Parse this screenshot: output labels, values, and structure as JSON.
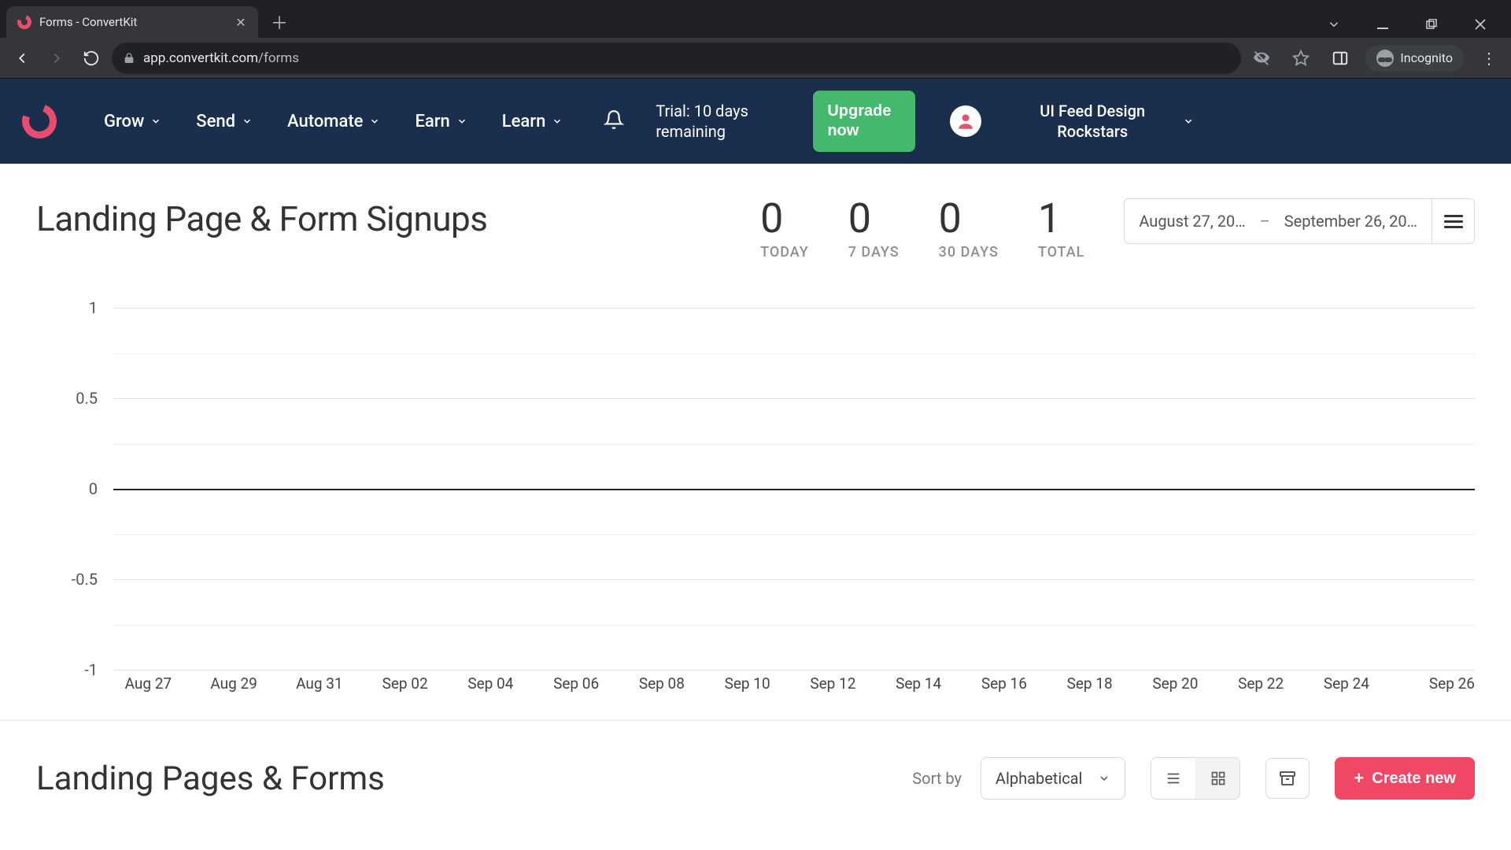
{
  "browser": {
    "tab_title": "Forms - ConvertKit",
    "url_host": "app.convertkit.com",
    "url_path": "/forms",
    "incognito_label": "Incognito"
  },
  "nav": {
    "items": [
      "Grow",
      "Send",
      "Automate",
      "Earn",
      "Learn"
    ],
    "trial_text": "Trial: 10 days remaining",
    "upgrade_label": "Upgrade now",
    "account_name": "UI Feed Design Rockstars"
  },
  "page": {
    "title": "Landing Page & Form Signups",
    "stats": [
      {
        "value": "0",
        "label": "TODAY"
      },
      {
        "value": "0",
        "label": "7 DAYS"
      },
      {
        "value": "0",
        "label": "30 DAYS"
      },
      {
        "value": "1",
        "label": "TOTAL"
      }
    ],
    "date_from": "August 27, 20…",
    "date_to": "September 26, 20…",
    "list_section_title": "Landing Pages & Forms",
    "sort_by_label": "Sort by",
    "sort_selected": "Alphabetical",
    "create_label": "Create new"
  },
  "chart_data": {
    "type": "line",
    "title": "Landing Page & Form Signups",
    "ylabel": "",
    "ylim": [
      -1,
      1
    ],
    "xlabel": "",
    "x": [
      "Aug 27",
      "Aug 29",
      "Aug 31",
      "Sep 02",
      "Sep 04",
      "Sep 06",
      "Sep 08",
      "Sep 10",
      "Sep 12",
      "Sep 14",
      "Sep 16",
      "Sep 18",
      "Sep 20",
      "Sep 22",
      "Sep 24",
      "Sep 26"
    ],
    "values": [
      0,
      0,
      0,
      0,
      0,
      0,
      0,
      0,
      0,
      0,
      0,
      0,
      0,
      0,
      0,
      0
    ],
    "y_ticks": [
      1,
      0.5,
      0,
      -0.5,
      -1
    ]
  }
}
